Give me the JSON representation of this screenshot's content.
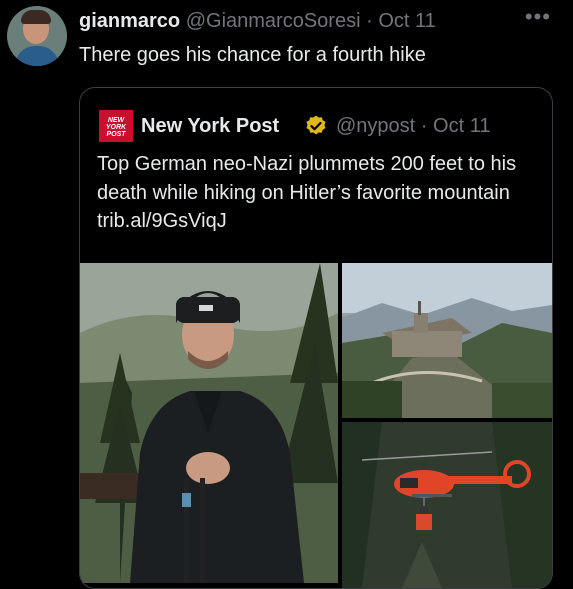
{
  "tweet": {
    "author_name": "gianmarco",
    "author_handle": "@GianmarcoSoresi",
    "separator": "·",
    "date": "Oct 11",
    "more_label": "•••",
    "text": "There goes his chance for a fourth hike"
  },
  "quote": {
    "logo_lines": [
      "NEW",
      "YORK",
      "POST"
    ],
    "author_name": "New York Post",
    "author_handle": "@nypost",
    "separator": "·",
    "date": "Oct 11",
    "text": "Top German neo-Nazi plummets 200 feet to his death while hiking on Hitler’s favorite mountain trib.al/9GsViqJ"
  },
  "colors": {
    "background": "#000000",
    "text_primary": "#e7e9ea",
    "text_secondary": "#71767b",
    "border": "#3b3f44",
    "verified_gold": "#e2b719",
    "nyp_red": "#c8102e",
    "helicopter": "#e0452a"
  }
}
